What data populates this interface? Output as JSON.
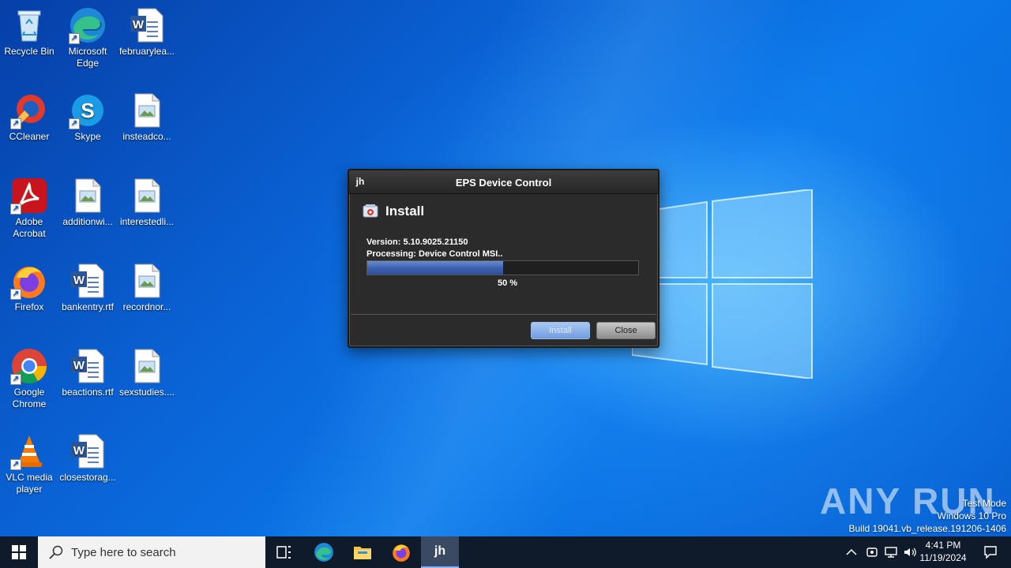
{
  "desktop": {
    "icons": [
      {
        "label": "Recycle Bin",
        "icon": "recycle-bin-icon"
      },
      {
        "label": "Microsoft Edge",
        "icon": "edge-icon"
      },
      {
        "label": "februarylea...",
        "icon": "word-doc-icon"
      },
      {
        "label": "CCleaner",
        "icon": "ccleaner-icon"
      },
      {
        "label": "Skype",
        "icon": "skype-icon"
      },
      {
        "label": "insteadco...",
        "icon": "image-file-icon"
      },
      {
        "label": "Adobe Acrobat",
        "icon": "acrobat-icon"
      },
      {
        "label": "additionwi...",
        "icon": "image-file-icon"
      },
      {
        "label": "interestedli...",
        "icon": "image-file-icon"
      },
      {
        "label": "Firefox",
        "icon": "firefox-icon"
      },
      {
        "label": "bankentry.rtf",
        "icon": "word-doc-icon"
      },
      {
        "label": "recordnor...",
        "icon": "image-file-icon"
      },
      {
        "label": "Google Chrome",
        "icon": "chrome-icon"
      },
      {
        "label": "beactions.rtf",
        "icon": "word-doc-icon"
      },
      {
        "label": "sexstudies....",
        "icon": "image-file-icon"
      },
      {
        "label": "VLC media player",
        "icon": "vlc-icon"
      },
      {
        "label": "closestorag...",
        "icon": "word-doc-icon"
      }
    ]
  },
  "dialog": {
    "title": "EPS Device Control",
    "app_icon_text": "jh",
    "heading": "Install",
    "version": "Version: 5.10.9025.21150",
    "processing": "Processing: Device Control MSI..",
    "progress_fraction": 0.5,
    "progress_text": "50 %",
    "install_label": "Install",
    "close_label": "Close"
  },
  "watermark": {
    "brand": "ANY RUN",
    "mode": "Test Mode",
    "edition": "Windows 10 Pro",
    "build": "Build 19041.vb_release.191206-1406"
  },
  "taskbar": {
    "search_placeholder": "Type here to search",
    "apps": [
      "task-view-icon",
      "edge-icon",
      "file-explorer-icon",
      "firefox-icon",
      "jh-app-icon"
    ],
    "active_app_text": "jh",
    "time": "4:41 PM",
    "date": "11/19/2024"
  }
}
